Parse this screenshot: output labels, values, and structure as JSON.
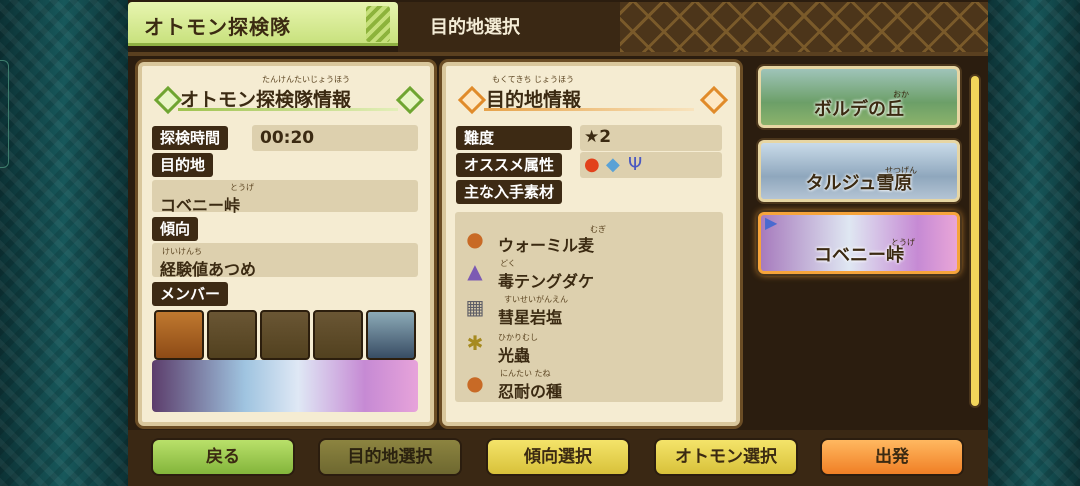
{
  "header": {
    "tab_title": "オトモン探検隊",
    "screen_title": "目的地選択"
  },
  "left_panel": {
    "title": "オトモン探検隊情報",
    "title_ruby": "たんけんたいじょうほう",
    "rows": {
      "time_label": "探検時間",
      "time_value": "00:20",
      "destination_label": "目的地",
      "destination_value": "コベニー峠",
      "destination_ruby": "とうげ",
      "trend_label": "傾向",
      "trend_value": "経験値あつめ",
      "trend_ruby": "けいけんち",
      "members_label": "メンバー"
    }
  },
  "middle_panel": {
    "title": "目的地情報",
    "title_ruby": "もくてきち じょうほう",
    "difficulty_label": "難度",
    "difficulty_value": "★2",
    "recommended_label": "オススメ属性",
    "materials_label": "主な入手素材",
    "materials": [
      {
        "name": "ウォーミル麦",
        "ruby": "むぎ",
        "icon": "sack-icon"
      },
      {
        "name": "毒テングダケ",
        "ruby": "どく",
        "icon": "mushroom-icon"
      },
      {
        "name": "彗星岩塩",
        "ruby": "すいせいがんえん",
        "icon": "ore-icon"
      },
      {
        "name": "光蟲",
        "ruby": "ひかりむし",
        "icon": "bug-icon"
      },
      {
        "name": "忍耐の種",
        "ruby": "にんたい たね",
        "icon": "sack-icon"
      }
    ]
  },
  "destinations": [
    {
      "name": "ボルデの丘",
      "ruby": "おか"
    },
    {
      "name": "タルジュ雪原",
      "ruby": "せつげん"
    },
    {
      "name": "コベニー峠",
      "ruby": "とうげ"
    }
  ],
  "buttons": {
    "back": "戻る",
    "destination_select": "目的地選択",
    "trend_select": "傾向選択",
    "otomon_select": "オトモン選択",
    "depart": "出発"
  }
}
